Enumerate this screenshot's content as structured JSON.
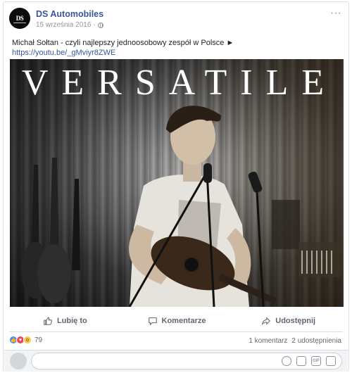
{
  "post": {
    "page_name": "DS Automobiles",
    "date": "15 września 2016",
    "separator": "·",
    "avatar_text": "DS",
    "text": "Michał Sołtan - czyli najlepszy jednoosobowy zespół w Polsce ►",
    "link": "https://youtu.be/_gMviyr8ZWE",
    "media_title": "VERSATILE"
  },
  "actions": {
    "like": "Lubię to",
    "comment": "Komentarze",
    "share": "Udostępnij"
  },
  "stats": {
    "reaction_count": "79",
    "comments": "1 komentarz",
    "shares": "2 udostępnienia"
  },
  "composer": {
    "placeholder": ""
  },
  "icons": {
    "more": "more-options-icon",
    "privacy": "globe-icon",
    "like": "thumbs-up-icon",
    "comment": "comment-bubble-icon",
    "share": "share-arrow-icon",
    "reactions": [
      "like-reaction-icon",
      "love-reaction-icon",
      "wow-reaction-icon"
    ],
    "composer": [
      "emoji-icon",
      "camera-icon",
      "gif-icon",
      "sticker-icon"
    ]
  },
  "colors": {
    "link": "#365899",
    "muted": "#90949c",
    "action_text": "#606770",
    "like_reaction": "#4b85f7",
    "love_reaction": "#f0445b",
    "wow_reaction": "#f7c94b"
  }
}
